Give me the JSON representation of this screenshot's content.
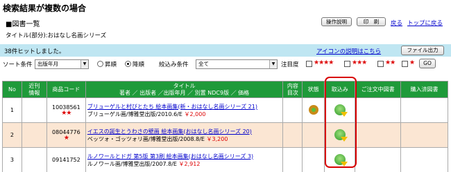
{
  "page": {
    "title": "検索結果が複数の場合"
  },
  "section": {
    "title": "■図書一覧"
  },
  "toolbar": {
    "manual": "操作説明",
    "print": "印　刷",
    "back": "戻る",
    "top_back": "トップに戻る"
  },
  "criteria": {
    "text": "タイトル(部分):おはなし名画シリーズ"
  },
  "hits": {
    "text": "38件ヒットしました。",
    "icon_help": "アイコンの説明はこちら",
    "file_out": "ファイル出力"
  },
  "sort": {
    "label": "ソート条件",
    "selected": "出版年月",
    "asc": "昇順",
    "desc": "降順",
    "narrow_label": "絞込み条件",
    "narrow_selected": "全て",
    "attention_label": "注目度",
    "go": "GO",
    "star_groups": [
      "★★★★",
      "★★★",
      "★★",
      "★"
    ]
  },
  "table": {
    "headers": {
      "no": "No",
      "info": "近刊\n情報",
      "code": "商品コード",
      "title_top": "タイトル",
      "title_sub": "著者 ／ 出版者 ／出版年月 ／ 別置 NDC9版 ／ 価格",
      "toc": "内容\n目次",
      "status": "状態",
      "add": "取込み",
      "ordering": "ご注文中図書",
      "purchased": "購入済図書"
    },
    "rows": [
      {
        "no": "1",
        "code": "10038561",
        "stars": "★★",
        "title": "ブリューゲルと村びとたち 絵本画集(新・おはなし名画シリーズ 21)",
        "meta": "ブリューゲル画/博雅堂出版/2010.6/E",
        "price": "￥2,000"
      },
      {
        "no": "2",
        "code": "08044776",
        "stars": "★",
        "title": "イエスの誕生とうわさの壁画 絵本画集(おはなし名画シリーズ 20)",
        "meta": "ベッツォ・ゴッツォリ画/博雅堂出版/2008.8/E",
        "price": "￥3,200"
      },
      {
        "no": "3",
        "code": "09141752",
        "stars": "",
        "title": "ルノワールとドガ 第5版 第3刷 絵本画集(おはなし名画シリーズ 3)",
        "meta": "ルノワール画/博雅堂出版/2007.8/E",
        "price": "￥2,912"
      }
    ]
  }
}
